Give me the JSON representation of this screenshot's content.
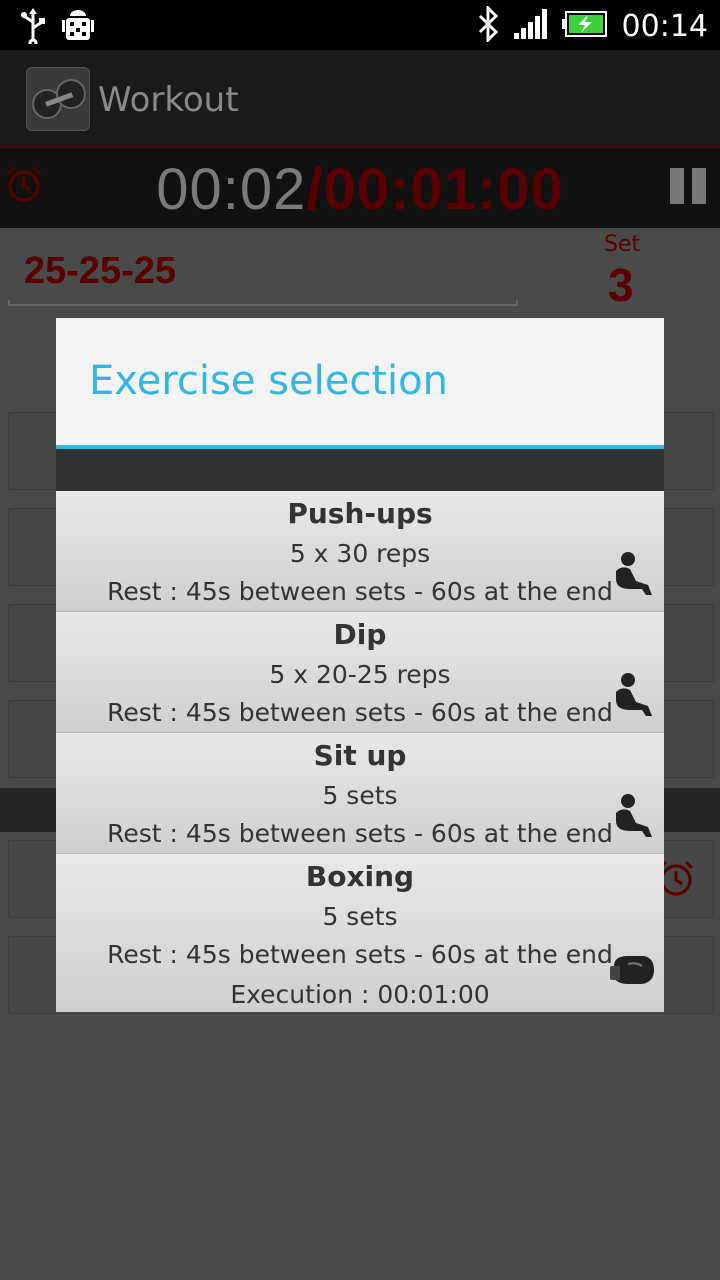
{
  "status_bar": {
    "time": "00:14"
  },
  "action_bar": {
    "title": "Workout"
  },
  "timer": {
    "elapsed": "00:02",
    "total": "/00:01:00"
  },
  "routine": {
    "name": "25-25-25",
    "set_label": "Set",
    "set_value": "3"
  },
  "dialog": {
    "title": "Exercise selection",
    "items": [
      {
        "name": "Push-ups",
        "sets": "5 x 30 reps",
        "rest": "Rest : 45s between sets - 60s at the end",
        "icon": "person-exercise-icon"
      },
      {
        "name": "Dip",
        "sets": "5 x 20-25 reps",
        "rest": "Rest : 45s between sets - 60s at the end",
        "icon": "person-exercise-icon"
      },
      {
        "name": "Sit up",
        "sets": "5 sets",
        "rest": "Rest : 45s between sets - 60s at the end",
        "icon": "person-exercise-icon"
      },
      {
        "name": "Boxing",
        "sets": "5 sets",
        "rest": "Rest : 45s between sets - 60s at the end",
        "execution": "Execution : 00:01:00",
        "icon": "boxing-glove-icon"
      }
    ]
  },
  "colors": {
    "accent": "#33b5e5",
    "timer_red": "#5a0000",
    "status_bar": "#000000"
  }
}
